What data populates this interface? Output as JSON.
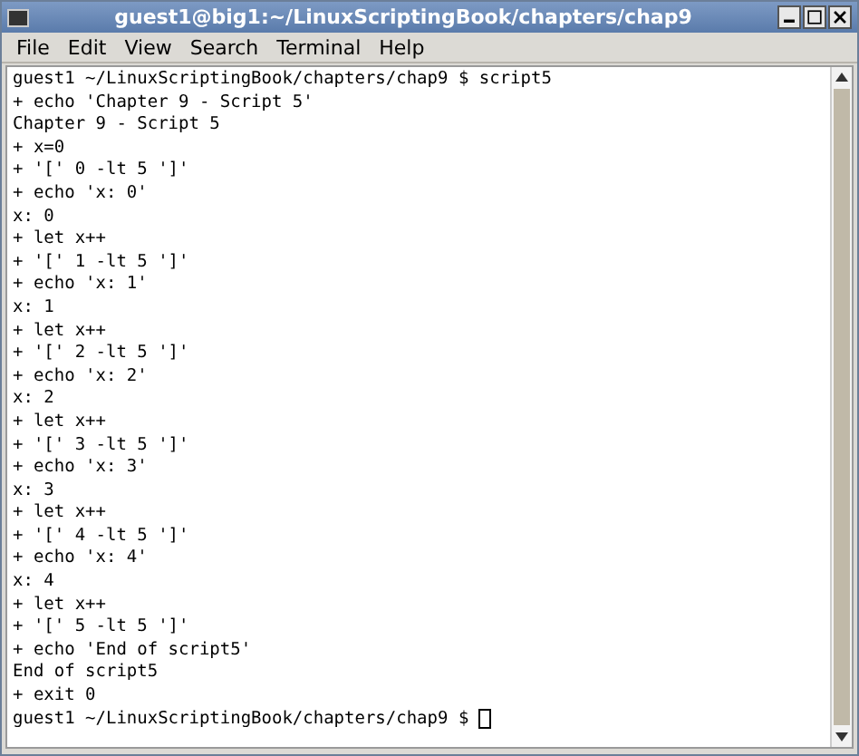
{
  "window": {
    "title": "guest1@big1:~/LinuxScriptingBook/chapters/chap9"
  },
  "menu": [
    "File",
    "Edit",
    "View",
    "Search",
    "Terminal",
    "Help"
  ],
  "terminal": {
    "cursor": true,
    "lines": [
      "guest1 ~/LinuxScriptingBook/chapters/chap9 $ script5",
      "+ echo 'Chapter 9 - Script 5'",
      "Chapter 9 - Script 5",
      "+ x=0",
      "+ '[' 0 -lt 5 ']'",
      "+ echo 'x: 0'",
      "x: 0",
      "+ let x++",
      "+ '[' 1 -lt 5 ']'",
      "+ echo 'x: 1'",
      "x: 1",
      "+ let x++",
      "+ '[' 2 -lt 5 ']'",
      "+ echo 'x: 2'",
      "x: 2",
      "+ let x++",
      "+ '[' 3 -lt 5 ']'",
      "+ echo 'x: 3'",
      "x: 3",
      "+ let x++",
      "+ '[' 4 -lt 5 ']'",
      "+ echo 'x: 4'",
      "x: 4",
      "+ let x++",
      "+ '[' 5 -lt 5 ']'",
      "+ echo 'End of script5'",
      "End of script5",
      "+ exit 0",
      "guest1 ~/LinuxScriptingBook/chapters/chap9 $"
    ]
  }
}
